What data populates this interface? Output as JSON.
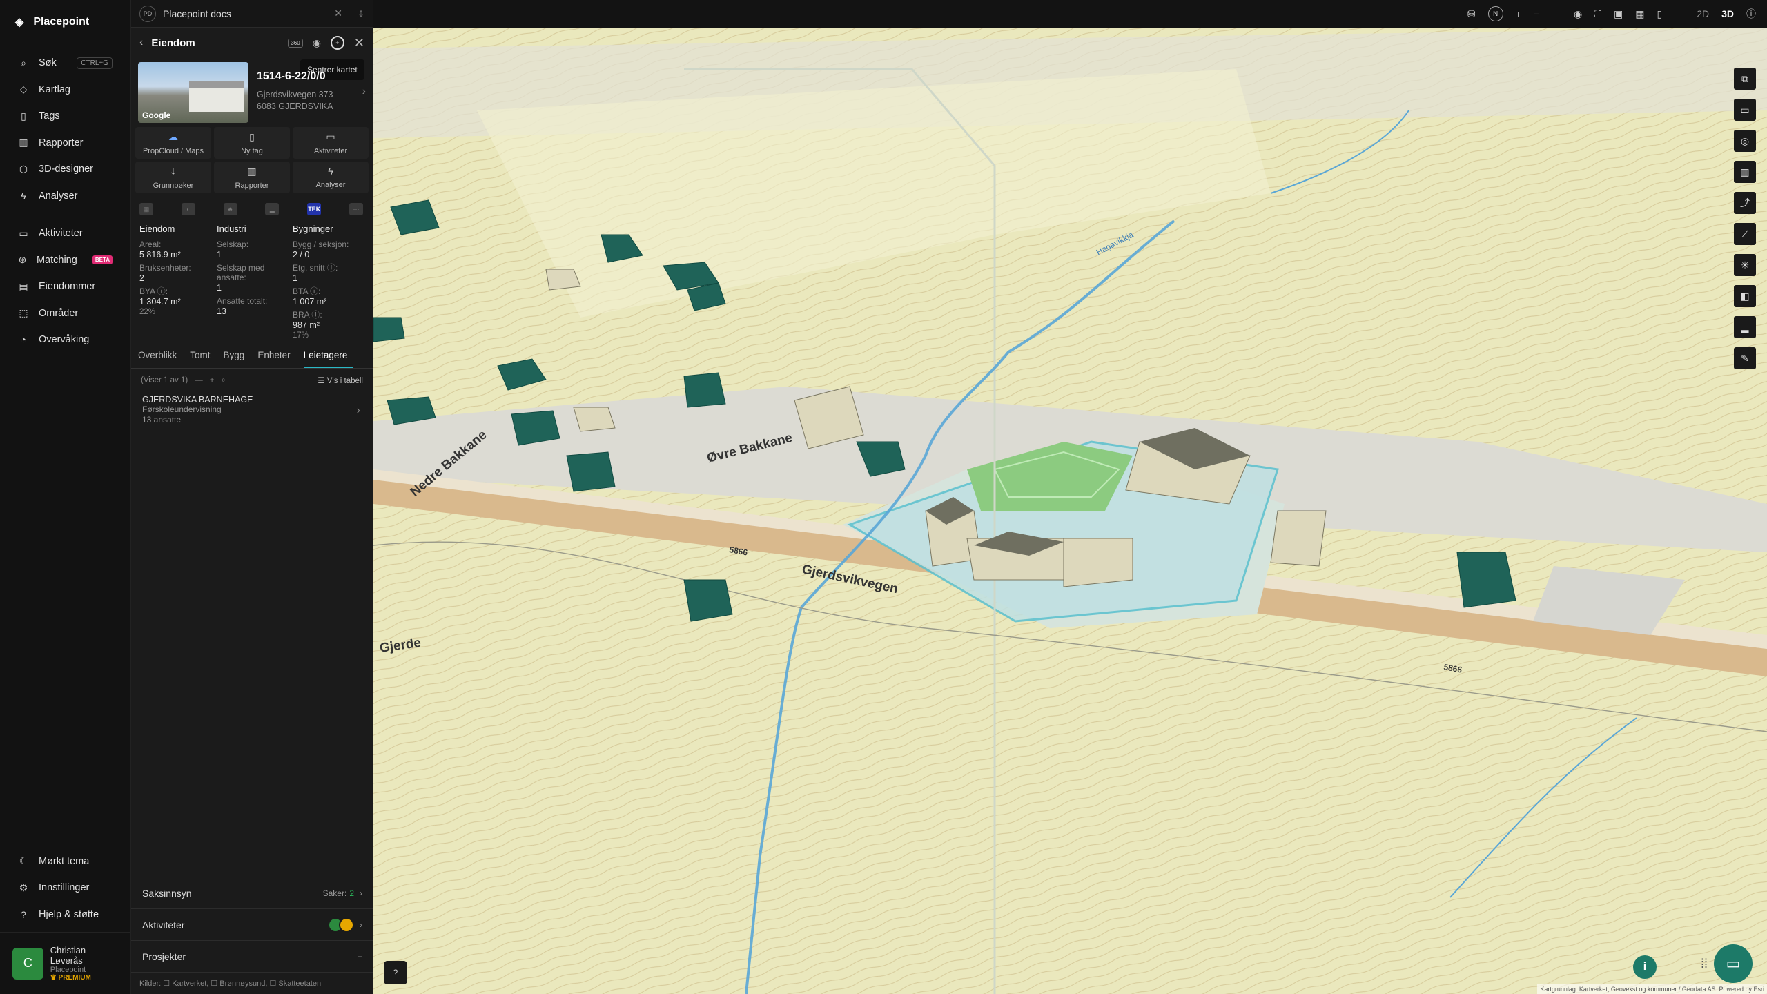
{
  "nav": {
    "brand": "Placepoint",
    "items": [
      {
        "label": "Søk",
        "icon": "search-icon",
        "kbd": "CTRL+G"
      },
      {
        "label": "Kartlag",
        "icon": "layers-icon"
      },
      {
        "label": "Tags",
        "icon": "bookmark-icon"
      },
      {
        "label": "Rapporter",
        "icon": "chart-icon"
      },
      {
        "label": "3D-designer",
        "icon": "cube-icon"
      },
      {
        "label": "Analyser",
        "icon": "bolt-icon"
      }
    ],
    "items2": [
      {
        "label": "Aktiviteter",
        "icon": "chat-icon"
      },
      {
        "label": "Matching",
        "icon": "match-icon",
        "badge": "BETA"
      },
      {
        "label": "Eiendommer",
        "icon": "building-icon"
      },
      {
        "label": "Områder",
        "icon": "area-icon"
      },
      {
        "label": "Overvåking",
        "icon": "monitor-icon"
      }
    ],
    "bottom": [
      {
        "label": "Mørkt tema",
        "icon": "moon-icon"
      },
      {
        "label": "Innstillinger",
        "icon": "gear-icon"
      },
      {
        "label": "Hjelp & støtte",
        "icon": "help-icon"
      }
    ],
    "user": {
      "initial": "C",
      "name": "Christian Løverås",
      "org": "Placepoint",
      "tier": "PREMIUM"
    }
  },
  "panel": {
    "top_badge": "PD",
    "top_title": "Placepoint docs",
    "title": "Eiendom",
    "tooltip": "Sentrer kartet",
    "gid": "1514-6-22/0/0",
    "address1": "Gjerdsvikvegen 373",
    "address2": "6083 GJERDSVIKA",
    "photo_brand": "Google",
    "quick": [
      {
        "label": "PropCloud / Maps",
        "icon": "cloud-icon"
      },
      {
        "label": "Ny tag",
        "icon": "tag-icon"
      },
      {
        "label": "Aktiviteter",
        "icon": "chat-icon"
      },
      {
        "label": "Grunnbøker",
        "icon": "download-icon"
      },
      {
        "label": "Rapporter",
        "icon": "chart-icon"
      },
      {
        "label": "Analyser",
        "icon": "bolt-icon"
      }
    ],
    "icons_row_tek": "TEK",
    "stats": {
      "eiendom": {
        "h": "Eiendom",
        "areal_l": "Areal:",
        "areal_v": "5 816.9 m²",
        "bruk_l": "Bruksenheter:",
        "bruk_v": "2",
        "bya_l": "BYA ⓘ:",
        "bya_v": "1 304.7 m²",
        "bya_p": "22%"
      },
      "industri": {
        "h": "Industri",
        "sel_l": "Selskap:",
        "sel_v": "1",
        "selans_l": "Selskap med ansatte:",
        "selans_v": "1",
        "ans_l": "Ansatte totalt:",
        "ans_v": "13"
      },
      "bygninger": {
        "h": "Bygninger",
        "bygg_l": "Bygg / seksjon:",
        "bygg_v": "2 / 0",
        "etg_l": "Etg. snitt ⓘ:",
        "etg_v": "1",
        "bta_l": "BTA ⓘ:",
        "bta_v": "1 007 m²",
        "bra_l": "BRA ⓘ:",
        "bra_v": "987 m²",
        "bra_p": "17%"
      }
    },
    "tabs": [
      "Overblikk",
      "Tomt",
      "Bygg",
      "Enheter",
      "Leietagere"
    ],
    "active_tab": "Leietagere",
    "table_info": "(Viser 1 av 1)",
    "table_toggle": "Vis i tabell",
    "tenant": {
      "name": "GJERDSVIKA BARNEHAGE",
      "desc": "Førskoleundervisning",
      "emp": "13 ansatte"
    },
    "rows": [
      {
        "label": "Saksinnsyn",
        "right": "Saker:",
        "count": "2"
      },
      {
        "label": "Aktiviteter"
      },
      {
        "label": "Prosjekter",
        "right": "+"
      }
    ],
    "sources": "Kilder: ☐ Kartverket, ☐ Brønnøysund, ☐ Skatteetaten"
  },
  "topbar": {
    "mode2d": "2D",
    "mode3d": "3D"
  },
  "map": {
    "labels": [
      "Øvre Bakkane",
      "Gjerdsvikvegen",
      "Nedre Bakkane",
      "Gjerde",
      "5866",
      "5866",
      "Hagavikkja"
    ],
    "attribution": "Kartgrunnlag: Kartverket, Geovekst og kommuner / Geodata AS. Powered by Esri"
  },
  "colors": {
    "accent": "#2ab8c6",
    "green": "#1d7a68",
    "terrain": "#e9e6b8",
    "road": "#d9b98d"
  }
}
